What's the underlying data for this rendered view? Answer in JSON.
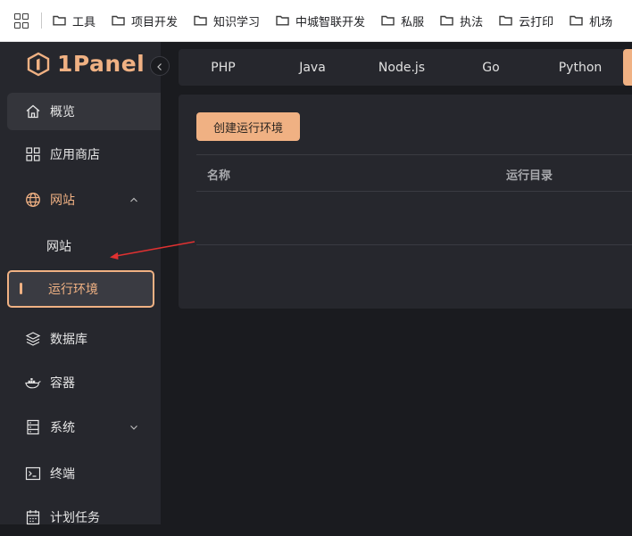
{
  "bookmarks": [
    {
      "label": "工具"
    },
    {
      "label": "项目开发"
    },
    {
      "label": "知识学习"
    },
    {
      "label": "中城智联开发"
    },
    {
      "label": "私服"
    },
    {
      "label": "执法"
    },
    {
      "label": "云打印"
    },
    {
      "label": "机场"
    }
  ],
  "logo": {
    "text": "1Panel"
  },
  "sidebar": {
    "overview": "概览",
    "app_store": "应用商店",
    "website": "网站",
    "website_sub": "网站",
    "runtime": "运行环境",
    "database": "数据库",
    "container": "容器",
    "system": "系统",
    "terminal": "终端",
    "cron": "计划任务"
  },
  "tabs": [
    "PHP",
    "Java",
    "Node.js",
    "Go",
    "Python"
  ],
  "toolbar": {
    "create_label": "创建运行环境"
  },
  "table": {
    "columns": [
      "名称",
      "运行目录"
    ]
  },
  "colors": {
    "accent": "#f0b183",
    "arrow": "#e03131",
    "sidebar_bg": "#26272d",
    "page_bg": "#1a1b1f"
  }
}
